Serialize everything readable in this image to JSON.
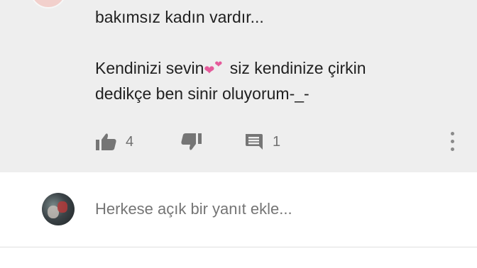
{
  "comment": {
    "line1": "bakımsız kadın vardır...",
    "line2_before_emoji": "Kendinizi sevin",
    "emoji": "two-hearts",
    "line2_after_emoji": " siz kendinize çirkin",
    "line3": "dedikçe ben sinir oluyorum-_-",
    "heart_color": "#e45a9a",
    "likes": "4",
    "replies": "1",
    "like_icon": "thumb-up-icon",
    "dislike_icon": "thumb-down-icon",
    "reply_icon": "comment-icon",
    "more_icon": "more-vertical-icon"
  },
  "reply_box": {
    "placeholder": "Herkese açık bir yanıt ekle..."
  },
  "colors": {
    "comment_bg": "#eeeeee",
    "icon": "#757575",
    "text": "#212121"
  }
}
